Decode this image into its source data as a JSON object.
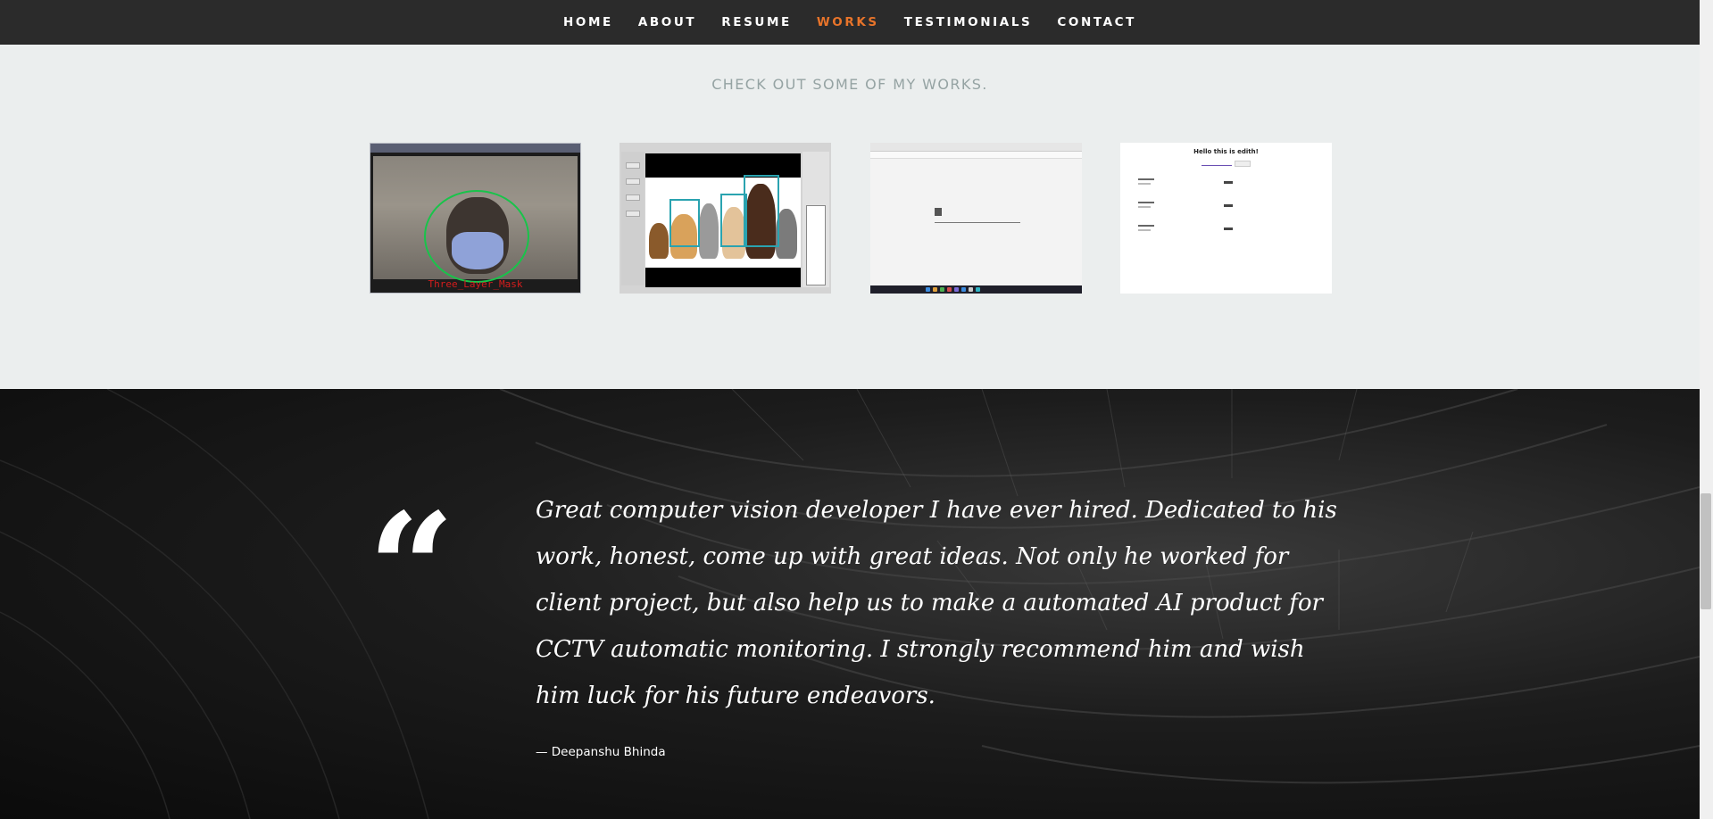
{
  "nav": {
    "items": [
      {
        "label": "HOME",
        "active": false
      },
      {
        "label": "ABOUT",
        "active": false
      },
      {
        "label": "RESUME",
        "active": false
      },
      {
        "label": "WORKS",
        "active": true
      },
      {
        "label": "TESTIMONIALS",
        "active": false
      },
      {
        "label": "CONTACT",
        "active": false
      }
    ],
    "accent_color": "#e8742a"
  },
  "works": {
    "heading": "CHECK OUT SOME OF MY WORKS.",
    "items": [
      {
        "caption": "Three_Layer_Mask"
      },
      {
        "caption": ""
      },
      {
        "caption": ""
      },
      {
        "caption": "Hello this is edith!"
      }
    ]
  },
  "testimonial": {
    "quote_icon": "quote-icon",
    "text": "Great computer vision developer I have ever hired. Dedicated to his work, honest, come up with great ideas. Not only he worked for client project, but also help us to make a automated AI product for CCTV automatic monitoring. I strongly recommend him and wish him luck for his future endeavors.",
    "author": "— Deepanshu Bhinda"
  }
}
